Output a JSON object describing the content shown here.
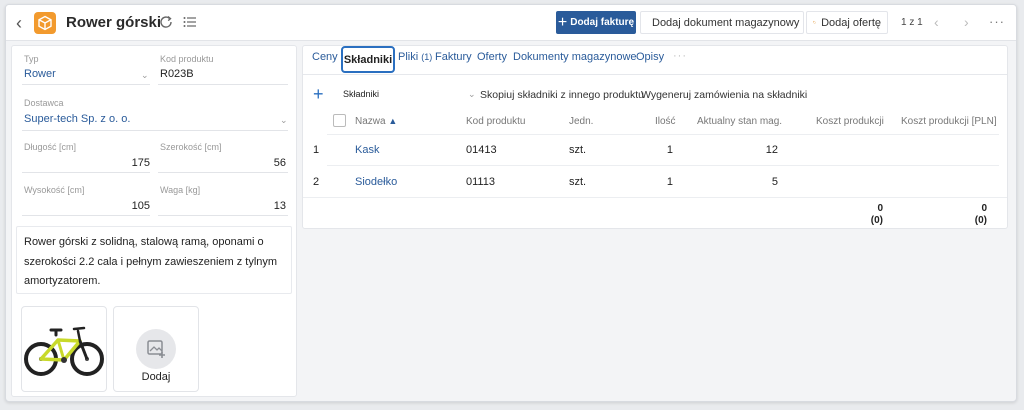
{
  "header": {
    "title": "Rower górski",
    "buttons": {
      "add_invoice": "Dodaj fakturę",
      "add_warehouse_doc": "Dodaj dokument magazynowy",
      "add_offer": "Dodaj ofertę"
    },
    "pager": "1 z 1"
  },
  "product": {
    "type_label": "Typ",
    "type_value": "Rower",
    "code_label": "Kod produktu",
    "code_value": "R023B",
    "supplier_label": "Dostawca",
    "supplier_value": "Super-tech Sp. z o. o.",
    "length_label": "Długość [cm]",
    "length_value": "175",
    "width_label": "Szerokość [cm]",
    "width_value": "56",
    "height_label": "Wysokość [cm]",
    "height_value": "105",
    "weight_label": "Waga [kg]",
    "weight_value": "13",
    "description": "Rower górski z solidną, stalową ramą, oponami o szerokości 2.2 cala i pełnym zawieszeniem z tylnym amortyzatorem.",
    "add_image_label": "Dodaj"
  },
  "tabs": [
    {
      "label": "Ceny"
    },
    {
      "label": "Składniki",
      "active": true
    },
    {
      "label": "Pliki",
      "count": "(1)"
    },
    {
      "label": "Faktury"
    },
    {
      "label": "Oferty"
    },
    {
      "label": "Dokumenty magazynowe"
    },
    {
      "label": "Opisy"
    }
  ],
  "components": {
    "section_title": "Składniki",
    "copy_action": "Skopiuj składniki z innego produktu",
    "generate_action": "Wygeneruj zamówienia na składniki",
    "columns": [
      "Nazwa",
      "Kod produktu",
      "Jedn.",
      "Ilość",
      "Aktualny stan mag.",
      "Koszt produkcji",
      "Koszt produkcji [PLN]"
    ],
    "rows": [
      {
        "index": "1",
        "name": "Kask",
        "code": "01413",
        "unit": "szt.",
        "qty": "1",
        "stock": "12"
      },
      {
        "index": "2",
        "name": "Siodełko",
        "code": "01113",
        "unit": "szt.",
        "qty": "1",
        "stock": "5"
      }
    ],
    "totals": {
      "cost": "0",
      "cost_sub": "(0)",
      "cost_pln": "0",
      "cost_pln_sub": "(0)"
    }
  },
  "colors": {
    "accent": "#2a5b9a",
    "app_icon": "#f29a2e",
    "active_tab_border": "#2a6fc0"
  }
}
